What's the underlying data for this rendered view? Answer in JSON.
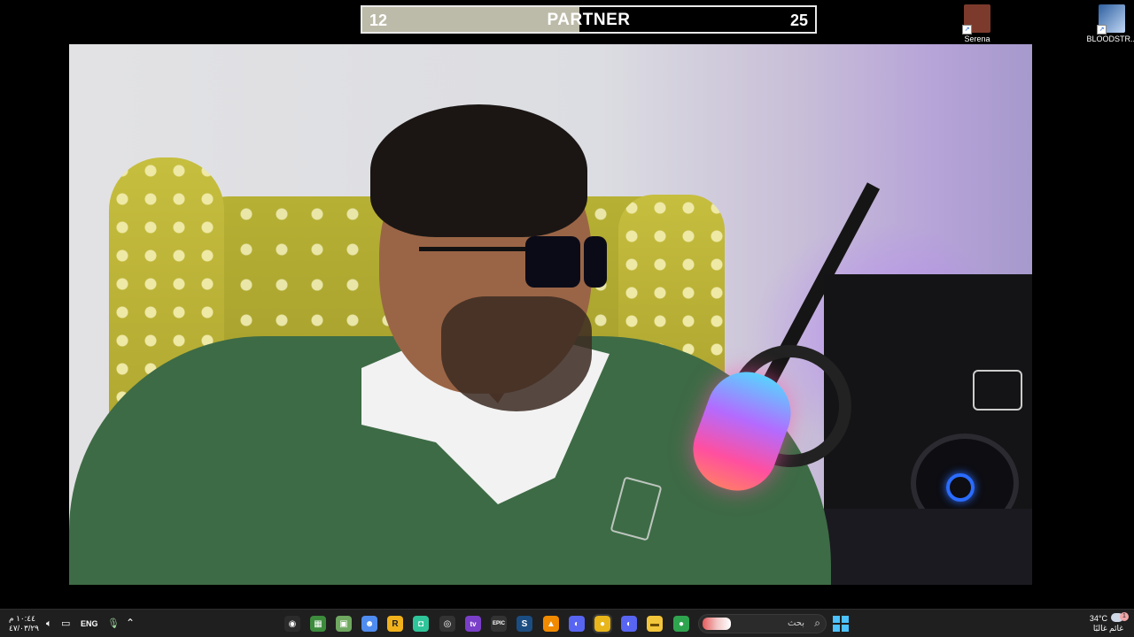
{
  "progress": {
    "left_value": "12",
    "right_value": "25",
    "label": "PARTNER",
    "fill_fraction": 0.48
  },
  "desktop": {
    "icons": [
      {
        "caption": "Serena",
        "color": "#8a3a2a"
      },
      {
        "caption": "BLOODSTR...",
        "color": "#3a6ea8"
      }
    ]
  },
  "taskbar": {
    "clock_time": "١٠:٤٤ م",
    "clock_date": "٤٧/٠٣/٢٩",
    "language": "ENG",
    "search_placeholder": "بحث",
    "weather_temp": "34°C",
    "weather_desc": "غائم غالبًا",
    "weather_alert": "1",
    "apps": [
      {
        "name": "obs",
        "glyph": "◉",
        "color": "#2b2b2b"
      },
      {
        "name": "minecraft",
        "glyph": "▦",
        "color": "#3c8c3c"
      },
      {
        "name": "creeper",
        "glyph": "▣",
        "color": "#6fa860"
      },
      {
        "name": "discord-nitro",
        "glyph": "☻",
        "color": "#4f8cf0"
      },
      {
        "name": "rockstar",
        "glyph": "R",
        "color": "#f1b21c"
      },
      {
        "name": "game",
        "glyph": "◘",
        "color": "#2fc59a"
      },
      {
        "name": "other",
        "glyph": "◎",
        "color": "#333"
      },
      {
        "name": "tv",
        "glyph": "tv",
        "color": "#7a3fc9"
      },
      {
        "name": "epic",
        "glyph": "EPIC",
        "color": "#333"
      },
      {
        "name": "steam",
        "glyph": "S",
        "color": "#1b4d82"
      },
      {
        "name": "vlc",
        "glyph": "▲",
        "color": "#f08a00"
      },
      {
        "name": "discord",
        "glyph": "◐",
        "color": "#5865f2"
      },
      {
        "name": "chrome",
        "glyph": "●",
        "color": "#e8b51a"
      },
      {
        "name": "discord-2",
        "glyph": "◐",
        "color": "#5865f2"
      },
      {
        "name": "files",
        "glyph": "▬",
        "color": "#f3c53b"
      },
      {
        "name": "chrome-2",
        "glyph": "●",
        "color": "#2fa44f"
      }
    ]
  }
}
